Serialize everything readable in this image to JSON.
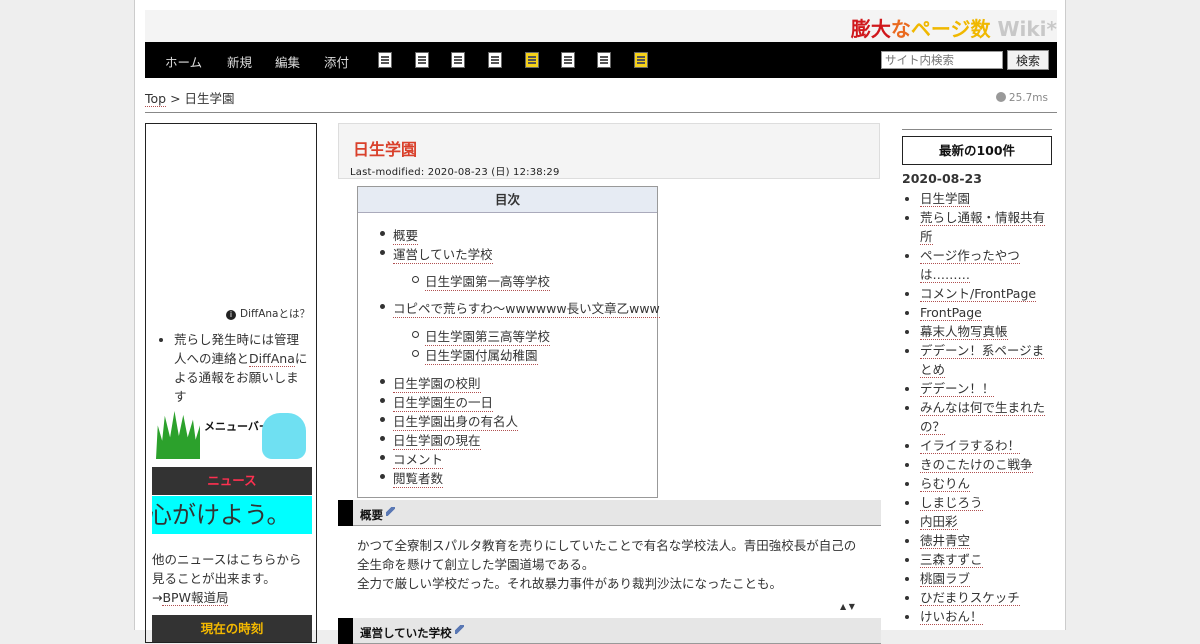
{
  "site": {
    "title_parts": [
      "膨大",
      "な",
      "ページ数",
      " Wiki*"
    ],
    "colors": {
      "red": "#d0181c",
      "orange": "#ea6a1f",
      "yellow": "#f0b800",
      "gray": "#c8c8c8"
    }
  },
  "nav": {
    "links": [
      "ホーム",
      "新規",
      "編集",
      "添付"
    ],
    "icons": [
      "list-icon",
      "search-page-icon",
      "diff-icon",
      "backup-icon",
      "lock-icon",
      "copy-icon",
      "new-page-icon",
      "help-icon"
    ],
    "search_placeholder": "サイト内検索",
    "search_button": "検索"
  },
  "breadcrumb": {
    "top": "Top",
    "sep": ">",
    "current": "日生学園"
  },
  "timing": "25.7ms",
  "left": {
    "diffana_link": "DiffAnaとは？",
    "notice_pre": "荒らし発生時には管理人への連絡と",
    "notice_link": "DiffAna",
    "notice_post": "による通報をお願いします",
    "menu_banner": "メニューバー",
    "news_head": "ニュース",
    "news_ticker": "心がけよう。",
    "news_more_pre": "他のニュースはこちらから見ることが出来ます。→",
    "news_more_link": "BPW報道局",
    "clock_head": "現在の時刻"
  },
  "main": {
    "title": "日生学園",
    "last_modified": "Last-modified: 2020-08-23 (日) 12:38:29",
    "toc_head": "目次",
    "toc": [
      {
        "label": "概要",
        "level": 1
      },
      {
        "label": "運営していた学校",
        "level": 1
      },
      {
        "label": "日生学園第一高等学校",
        "level": 2
      },
      {
        "label": "コピペで荒らすわ～wwwwww長い文章乙www",
        "level": 1
      },
      {
        "label": "日生学園第三高等学校",
        "level": 2
      },
      {
        "label": "日生学園付属幼稚園",
        "level": 2
      },
      {
        "label": "日生学園の校則",
        "level": 1
      },
      {
        "label": "日生学園生の一日",
        "level": 1
      },
      {
        "label": "日生学園出身の有名人",
        "level": 1
      },
      {
        "label": "日生学園の現在",
        "level": 1
      },
      {
        "label": "コメント",
        "level": 1
      },
      {
        "label": "閲覧者数",
        "level": 1
      }
    ],
    "section1": "概要",
    "para_line1": "かつて全寮制スパルタ教育を売りにしていたことで有名な学校法人。青田強校長が自己の",
    "para_line2": "全生命を懸けて創立した学園道場である。",
    "para_line3": "全力で厳しい学校だった。それ故暴力事件があり裁判沙汰になったことも。",
    "arrows": "▲ ▼",
    "section2": "運営していた学校"
  },
  "right": {
    "recent_head": "最新の100件",
    "date": "2020-08-23",
    "items": [
      "日生学園",
      "荒らし通報・情報共有所",
      "ページ作ったやつは………",
      "コメント/FrontPage",
      "FrontPage",
      "幕末人物写真帳",
      "デデーン！系ページまとめ",
      "デデーン！！",
      "みんなは何で生まれたの？",
      "イライラするわ！",
      "きのこたけのこ戦争",
      "らむりん",
      "しまじろう",
      "内田彩",
      "徳井青空",
      "三森すずこ",
      "桃園ラブ",
      "ひだまりスケッチ",
      "けいおん！"
    ]
  }
}
